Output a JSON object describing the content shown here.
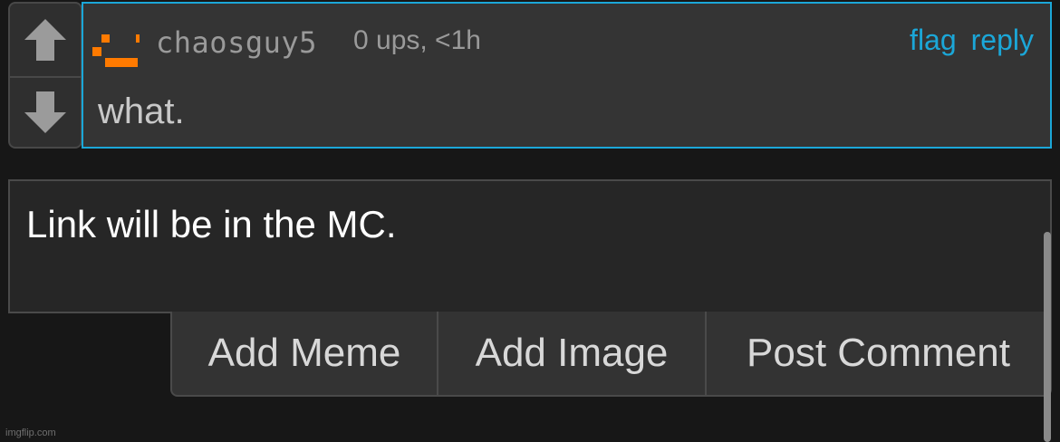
{
  "comment": {
    "username": "chaosguy5",
    "meta": "0 ups, <1h",
    "text": "what.",
    "actions": {
      "flag": "flag",
      "reply": "reply"
    }
  },
  "vote": {
    "up_icon": "arrow-up-icon",
    "down_icon": "arrow-down-icon"
  },
  "editor": {
    "text": "Link will be in the MC."
  },
  "buttons": {
    "add_meme": "Add Meme",
    "add_image": "Add Image",
    "post_comment": "Post Comment"
  },
  "watermark": "imgflip.com",
  "colors": {
    "accent": "#1ba7d8",
    "avatar": "#ff7a00",
    "background": "#171717",
    "comment_bg": "#343434"
  }
}
